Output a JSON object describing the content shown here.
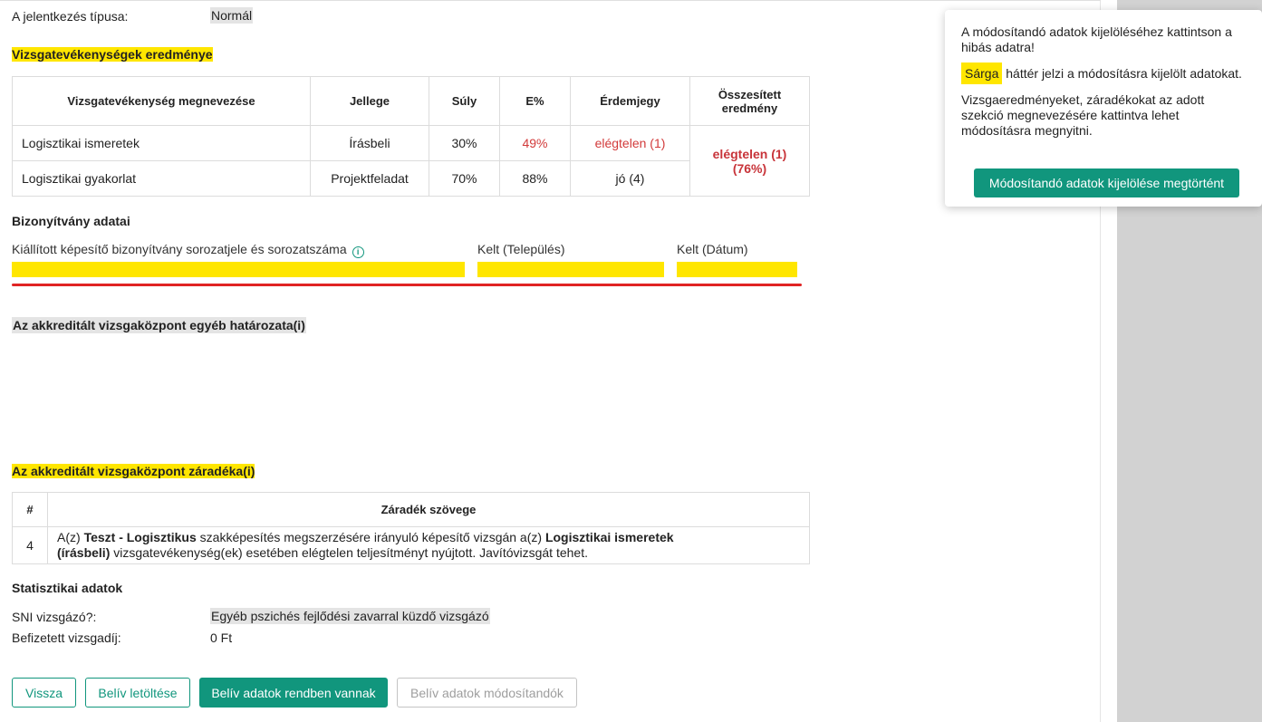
{
  "header": {
    "report_type_label": "A jelentkezés típusa:",
    "report_type_value": "Normál"
  },
  "results": {
    "title": "Vizsgatevékenységek eredménye",
    "columns": [
      "Vizsgatevékenység megnevezése",
      "Jellege",
      "Súly",
      "E%",
      "Érdemjegy",
      "Összesített eredmény"
    ],
    "rows": [
      {
        "name": "Logisztikai ismeretek",
        "type": "Írásbeli",
        "weight": "30%",
        "percent": "49%",
        "grade": "elégtelen (1)"
      },
      {
        "name": "Logisztikai gyakorlat",
        "type": "Projektfeladat",
        "weight": "70%",
        "percent": "88%",
        "grade": "jó (4)"
      }
    ],
    "total_grade": "elégtelen (1)",
    "total_percent": "(76%)"
  },
  "certificate": {
    "title": "Bizonyítvány adatai",
    "serial_label": "Kiállított képesítő bizonyítvány sorozatjele és sorozatszáma",
    "place_label": "Kelt (Település)",
    "date_label": "Kelt (Dátum)",
    "info_icon": "i"
  },
  "other_decision": {
    "title": "Az akkreditált vizsgaközpont egyéb határozata(i)"
  },
  "clause": {
    "title": "Az akkreditált vizsgaközpont záradéka(i)",
    "columns": [
      "#",
      "Záradék szövege"
    ],
    "row_number": "4",
    "text_parts": {
      "p1": "A(z) ",
      "b1": "Teszt - Logisztikus",
      "p2": " szakképesítés megszerzésére irányuló képesítő vizsgán a(z) ",
      "b2": "Logisztikai ismeretek",
      "b3": "(írásbeli)",
      "p3": " vizsgatevékenység(ek) esetében elégtelen teljesítményt nyújtott. Javítóvizsgát tehet."
    }
  },
  "statistics": {
    "title": "Statisztikai adatok",
    "sni_label": "SNI vizsgázó?:",
    "sni_value": "Egyéb pszichés fejlődési zavarral küzdő vizsgázó",
    "fee_label": "Befizetett vizsgadíj:",
    "fee_value": "0 Ft"
  },
  "buttons": {
    "back": "Vissza",
    "download": "Belív letöltése",
    "ok": "Belív adatok rendben vannak",
    "modify": "Belív adatok módosítandók"
  },
  "popover": {
    "line1": "A módosítandó adatok kijelöléséhez kattintson a hibás adatra!",
    "yellow_word": "Sárga",
    "line2_rest": " háttér jelzi a módosításra kijelölt adatokat.",
    "line3": "Vizsgaeredményeket, záradékokat az adott szekció megnevezésére kattintva lehet módosításra megnyitni.",
    "confirm_button": "Módosítandó adatok kijelölése megtörtént"
  },
  "colors": {
    "accent": "#11967d",
    "highlight": "#ffe600",
    "error": "#d23a3a"
  }
}
